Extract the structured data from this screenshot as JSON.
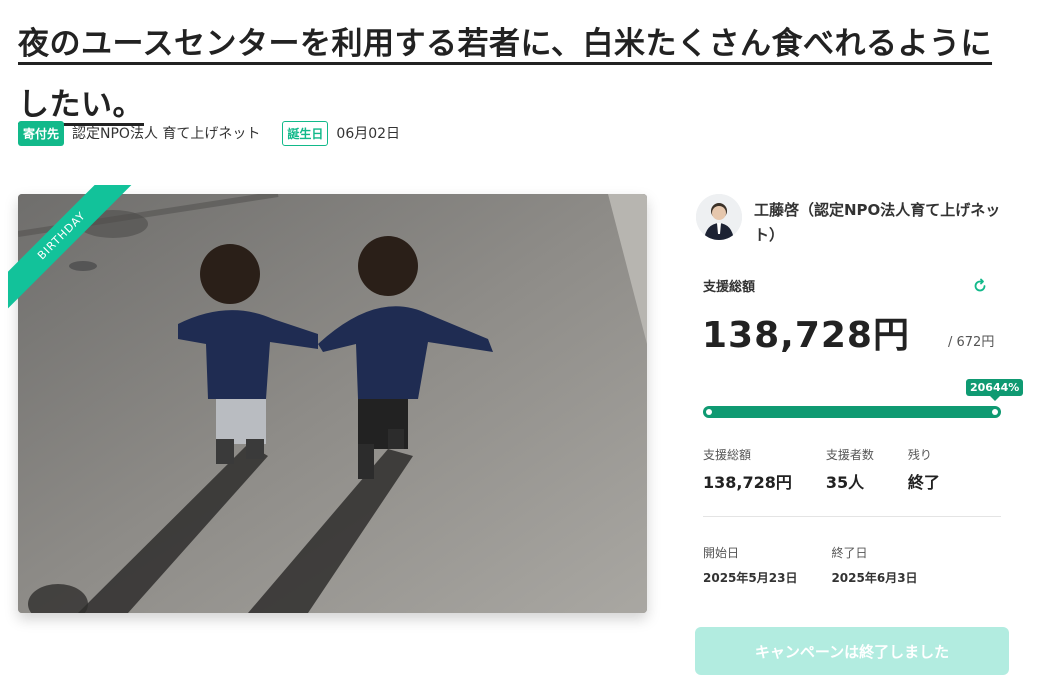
{
  "project": {
    "title": "夜のユースセンターを利用する若者に、白米たくさん食べれるようにしたい。",
    "recipient_label": "寄付先",
    "recipient_name": "認定NPO法人 育て上げネット",
    "birthday_label": "誕生日",
    "birthday_date": "06月02日",
    "ribbon_text": "BIRTHDAY"
  },
  "owner": {
    "name": "工藤啓（認定NPO法人育て上げネット）"
  },
  "funding": {
    "total_label": "支援総額",
    "total_amount": "138,728円",
    "goal": "/ 672円",
    "percent_text": "20644%",
    "progress": 1.0
  },
  "stats": [
    {
      "label": "支援総額",
      "value": "138,728円"
    },
    {
      "label": "支援者数",
      "value": "35人"
    },
    {
      "label": "残り",
      "value": "終了"
    }
  ],
  "dates": [
    {
      "label": "開始日",
      "value": "2025年5月23日"
    },
    {
      "label": "終了日",
      "value": "2025年6月3日"
    }
  ],
  "cta": {
    "label": "キャンペーンは終了しました"
  },
  "colors": {
    "brand": "#12b98a",
    "progress": "#0f9a72",
    "button_disabled": "#b2ece0"
  },
  "icons": {
    "refresh": "refresh-icon"
  }
}
